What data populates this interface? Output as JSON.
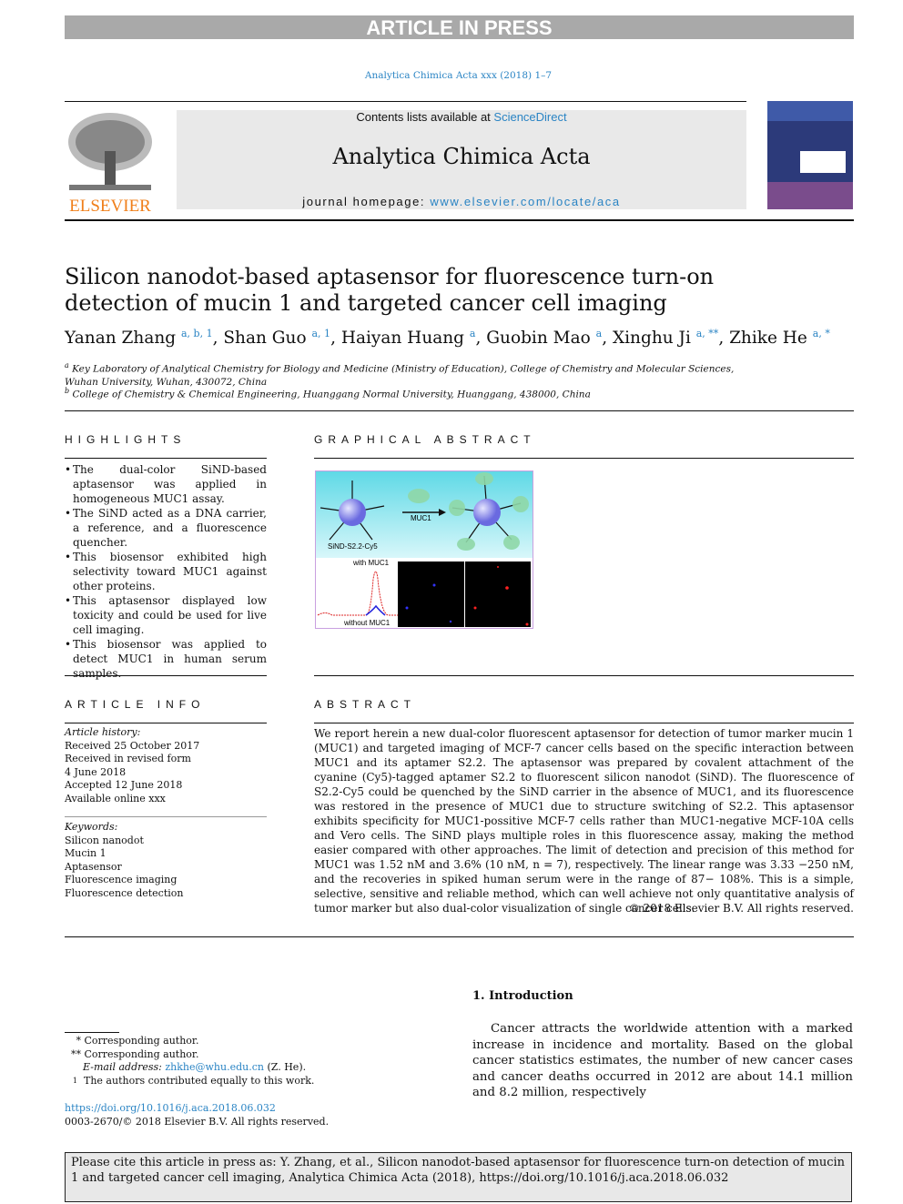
{
  "banner": "ARTICLE IN PRESS",
  "journal_ref": "Analytica Chimica Acta xxx (2018) 1–7",
  "header": {
    "contents_prefix": "Contents lists available at ",
    "contents_link": "ScienceDirect",
    "journal_title": "Analytica Chimica Acta",
    "homepage_prefix": "journal homepage: ",
    "homepage_link": "www.elsevier.com/locate/aca",
    "publisher": "ELSEVIER"
  },
  "article": {
    "title": "Silicon nanodot-based aptasensor for fluorescence turn-on detection of mucin 1 and targeted cancer cell imaging",
    "authors": [
      {
        "name": "Yanan Zhang",
        "sup": "a, b, 1"
      },
      {
        "name": "Shan Guo",
        "sup": "a, 1"
      },
      {
        "name": "Haiyan Huang",
        "sup": "a"
      },
      {
        "name": "Guobin Mao",
        "sup": "a"
      },
      {
        "name": "Xinghu Ji",
        "sup": "a, **"
      },
      {
        "name": "Zhike He",
        "sup": "a, *"
      }
    ],
    "affiliations": [
      {
        "mark": "a",
        "text": "Key Laboratory of Analytical Chemistry for Biology and Medicine (Ministry of Education), College of Chemistry and Molecular Sciences, Wuhan University, Wuhan, 430072, China"
      },
      {
        "mark": "b",
        "text": "College of Chemistry & Chemical Engineering, Huanggang Normal University, Huanggang, 438000, China"
      }
    ]
  },
  "highlights": {
    "heading": "HIGHLIGHTS",
    "items": [
      "The dual-color SiND-based aptasensor was applied in homogeneous MUC1 assay.",
      "The SiND acted as a DNA carrier, a reference, and a fluorescence quencher.",
      "This biosensor exhibited high selectivity toward MUC1 against other proteins.",
      "This aptasensor displayed low toxicity and could be used for live cell imaging.",
      "This biosensor was applied to detect MUC1 in human serum samples."
    ]
  },
  "graphical_abstract": {
    "heading": "GRAPHICAL ABSTRACT",
    "labels": {
      "arrow": "MUC1",
      "probe": "SiND-S2.2-Cy5",
      "with": "with MUC1",
      "without": "without MUC1"
    }
  },
  "article_info": {
    "heading": "ARTICLE INFO",
    "history_label": "Article history:",
    "history": [
      "Received 25 October 2017",
      "Received in revised form",
      "4 June 2018",
      "Accepted 12 June 2018",
      "Available online xxx"
    ],
    "keywords_label": "Keywords:",
    "keywords": [
      "Silicon nanodot",
      "Mucin 1",
      "Aptasensor",
      "Fluorescence imaging",
      "Fluorescence detection"
    ]
  },
  "abstract": {
    "heading": "ABSTRACT",
    "text": "We report herein a new dual-color fluorescent aptasensor for detection of tumor marker mucin 1 (MUC1) and targeted imaging of MCF-7 cancer cells based on the specific interaction between MUC1 and its aptamer S2.2. The aptasensor was prepared by covalent attachment of the cyanine (Cy5)-tagged aptamer S2.2 to fluorescent silicon nanodot (SiND). The fluorescence of S2.2-Cy5 could be quenched by the SiND carrier in the absence of MUC1, and its fluorescence was restored in the presence of MUC1 due to structure switching of S2.2. This aptasensor exhibits specificity for MUC1-possitive MCF-7 cells rather than MUC1-negative MCF-10A cells and Vero cells. The SiND plays multiple roles in this fluorescence assay, making the method easier compared with other approaches. The limit of detection and precision of this method for MUC1 was 1.52 nM and 3.6% (10 nM, n = 7), respectively. The linear range was 3.33 −250 nM, and the recoveries in spiked human serum were in the range of 87− 108%. This is a simple, selective, sensitive and reliable method, which can well achieve not only quantitative analysis of tumor marker but also dual-color visualization of single cancer cells.",
    "copyright": "© 2018 Elsevier B.V. All rights reserved."
  },
  "intro": {
    "heading": "1.  Introduction",
    "text": "Cancer attracts the worldwide attention with a marked increase in incidence and mortality. Based on the global cancer statistics estimates, the number of new cancer cases and cancer deaths occurred in 2012 are about 14.1 million and 8.2 million, respectively"
  },
  "footnotes": {
    "star1_mark": "*",
    "star1": "Corresponding author.",
    "star2_mark": "**",
    "star2": "Corresponding author.",
    "email_label": "E-mail address: ",
    "email": "zhkhe@whu.edu.cn",
    "email_suffix": " (Z. He).",
    "one_mark": "1",
    "one": "The authors contributed equally to this work.",
    "doi": "https://doi.org/10.1016/j.aca.2018.06.032",
    "issn": "0003-2670/© 2018 Elsevier B.V. All rights reserved."
  },
  "cite_box": "Please cite this article in press as: Y. Zhang, et al., Silicon nanodot-based aptasensor for fluorescence turn-on detection of mucin 1 and targeted cancer cell imaging, Analytica Chimica Acta (2018), https://doi.org/10.1016/j.aca.2018.06.032",
  "colors": {
    "link": "#2a84c4",
    "banner": "#a9a9a9",
    "elsevier": "#f07f1a"
  }
}
